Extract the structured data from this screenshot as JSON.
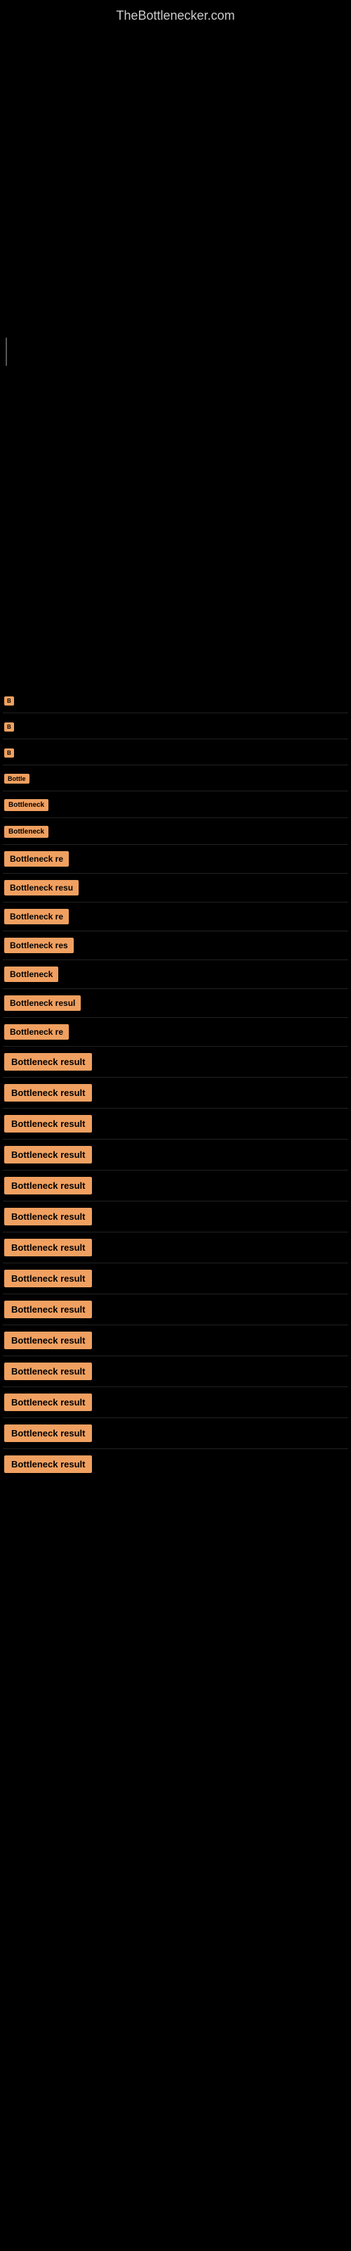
{
  "site": {
    "title": "TheBottlenecker.com"
  },
  "items": [
    {
      "id": 1,
      "label": "B",
      "size": "xs"
    },
    {
      "id": 2,
      "label": "B",
      "size": "xs"
    },
    {
      "id": 3,
      "label": "B",
      "size": "xs"
    },
    {
      "id": 4,
      "label": "Bottle",
      "size": "sm"
    },
    {
      "id": 5,
      "label": "Bottleneck",
      "size": "md"
    },
    {
      "id": 6,
      "label": "Bottleneck",
      "size": "md"
    },
    {
      "id": 7,
      "label": "Bottleneck re",
      "size": "normal"
    },
    {
      "id": 8,
      "label": "Bottleneck resu",
      "size": "normal"
    },
    {
      "id": 9,
      "label": "Bottleneck re",
      "size": "normal"
    },
    {
      "id": 10,
      "label": "Bottleneck res",
      "size": "normal"
    },
    {
      "id": 11,
      "label": "Bottleneck",
      "size": "normal"
    },
    {
      "id": 12,
      "label": "Bottleneck resul",
      "size": "normal"
    },
    {
      "id": 13,
      "label": "Bottleneck re",
      "size": "normal"
    },
    {
      "id": 14,
      "label": "Bottleneck result",
      "size": "full"
    },
    {
      "id": 15,
      "label": "Bottleneck result",
      "size": "full"
    },
    {
      "id": 16,
      "label": "Bottleneck result",
      "size": "full"
    },
    {
      "id": 17,
      "label": "Bottleneck result",
      "size": "full"
    },
    {
      "id": 18,
      "label": "Bottleneck result",
      "size": "full"
    },
    {
      "id": 19,
      "label": "Bottleneck result",
      "size": "full"
    },
    {
      "id": 20,
      "label": "Bottleneck result",
      "size": "full"
    },
    {
      "id": 21,
      "label": "Bottleneck result",
      "size": "full"
    },
    {
      "id": 22,
      "label": "Bottleneck result",
      "size": "full"
    },
    {
      "id": 23,
      "label": "Bottleneck result",
      "size": "full"
    },
    {
      "id": 24,
      "label": "Bottleneck result",
      "size": "full"
    },
    {
      "id": 25,
      "label": "Bottleneck result",
      "size": "full"
    },
    {
      "id": 26,
      "label": "Bottleneck result",
      "size": "full"
    },
    {
      "id": 27,
      "label": "Bottleneck result",
      "size": "full"
    }
  ]
}
